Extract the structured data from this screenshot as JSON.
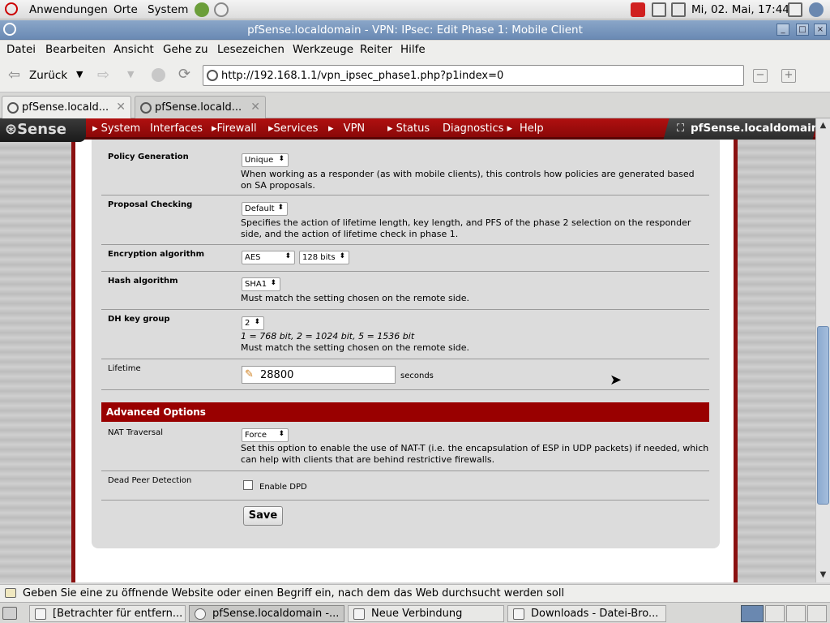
{
  "panel": {
    "menus": [
      "Anwendungen",
      "Orte",
      "System"
    ],
    "clock": "Mi, 02. Mai, 17:44"
  },
  "window": {
    "title": "pfSense.localdomain - VPN: IPsec: Edit Phase 1: Mobile Client"
  },
  "menubar": [
    "Datei",
    "Bearbeiten",
    "Ansicht",
    "Gehe zu",
    "Lesezeichen",
    "Werkzeuge",
    "Reiter",
    "Hilfe"
  ],
  "nav": {
    "back_label": "Zurück",
    "url": "http://192.168.1.1/vpn_ipsec_phase1.php?p1index=0"
  },
  "tabs": [
    "pfSense.locald...",
    "pfSense.locald..."
  ],
  "pf": {
    "logo": "Sense",
    "menu": [
      "System",
      "Interfaces",
      "Firewall",
      "Services",
      "VPN",
      "Status",
      "Diagnostics",
      "Help"
    ],
    "host": "pfSense.localdomain"
  },
  "form": {
    "policy_generation": {
      "label": "Policy Generation",
      "value": "Unique",
      "desc": "When working as a responder (as with mobile clients), this controls how policies are generated based on SA proposals."
    },
    "proposal_checking": {
      "label": "Proposal Checking",
      "value": "Default",
      "desc": "Specifies the action of lifetime length, key length, and PFS of the phase 2 selection on the responder side, and the action of lifetime check in phase 1."
    },
    "encryption": {
      "label": "Encryption algorithm",
      "algo": "AES",
      "bits": "128 bits"
    },
    "hash": {
      "label": "Hash algorithm",
      "value": "SHA1",
      "desc": "Must match the setting chosen on the remote side."
    },
    "dh": {
      "label": "DH key group",
      "value": "2",
      "note": "1 = 768 bit, 2 = 1024 bit, 5 = 1536 bit",
      "desc": "Must match the setting chosen on the remote side."
    },
    "lifetime": {
      "label": "Lifetime",
      "value": "28800",
      "unit": "seconds"
    },
    "advanced_header": "Advanced Options",
    "nat": {
      "label": "NAT Traversal",
      "value": "Force",
      "desc": "Set this option to enable the use of NAT-T (i.e. the encapsulation of ESP in UDP packets) if needed, which can help with clients that are behind restrictive firewalls."
    },
    "dpd": {
      "label": "Dead Peer Detection",
      "checkbox_label": "Enable DPD",
      "checked": false
    },
    "save_label": "Save"
  },
  "status_text": "Geben Sie eine zu öffnende Website oder einen Begriff ein, nach dem das Web durchsucht werden soll",
  "taskbar": [
    "[Betrachter für entfern...",
    "pfSense.localdomain -...",
    "Neue Verbindung",
    "Downloads - Datei-Bro..."
  ],
  "colors": {
    "pf_red": "#990000",
    "title_blue": "#7a98c0"
  }
}
